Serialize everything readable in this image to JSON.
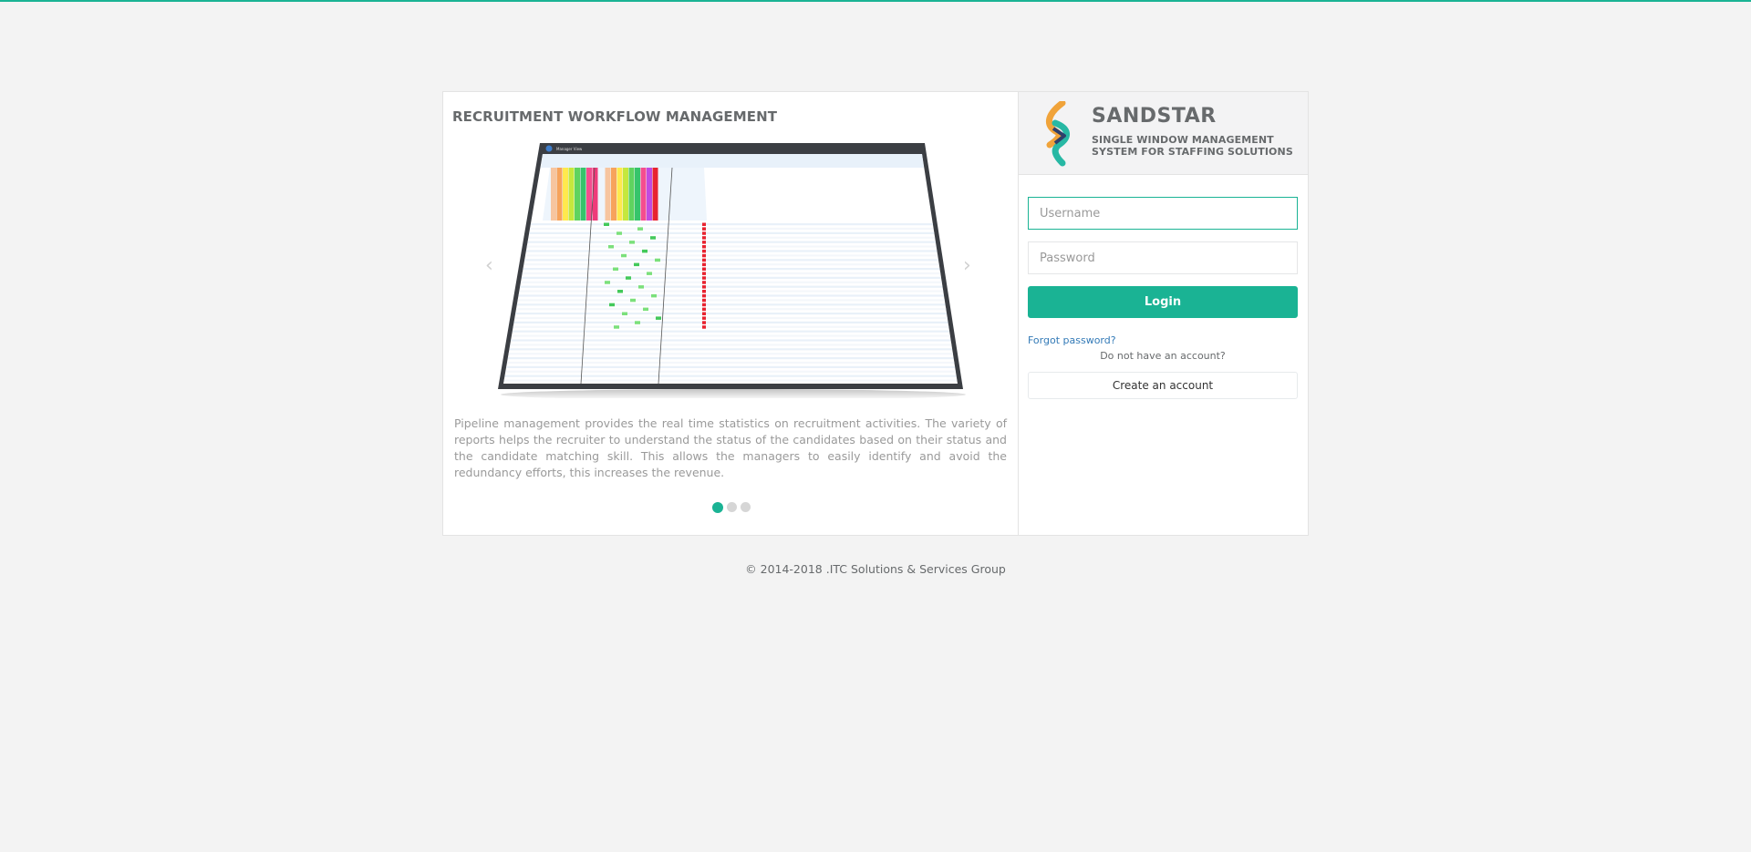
{
  "colors": {
    "accent": "#1ab394",
    "link": "#337ab7",
    "background": "#f3f3f3"
  },
  "carousel": {
    "title": "RECRUITMENT WORKFLOW MANAGEMENT",
    "image_caption_icon": "dashboard-screenshot",
    "screenshot_window_title": "Manager View",
    "description": "Pipeline management provides the real time statistics on recruitment activities. The variety of reports helps the recruiter to understand the status of the candidates based on their status and the candidate matching skill. This allows the managers to easily identify and avoid the redundancy efforts, this increases the revenue.",
    "prev_icon": "chevron-left-icon",
    "next_icon": "chevron-right-icon",
    "slide_count": 3,
    "active_slide": 1
  },
  "brand": {
    "name": "SANDSTAR",
    "tagline_line1": "SINGLE WINDOW MANAGEMENT",
    "tagline_line2": "SYSTEM FOR STAFFING SOLUTIONS"
  },
  "login": {
    "username_placeholder": "Username",
    "password_placeholder": "Password",
    "login_label": "Login",
    "forgot_label": "Forgot password?",
    "no_account_text": "Do not have an account?",
    "create_label": "Create an account"
  },
  "footer": {
    "copyright": "© 2014-2018 .ITC Solutions & Services Group"
  }
}
